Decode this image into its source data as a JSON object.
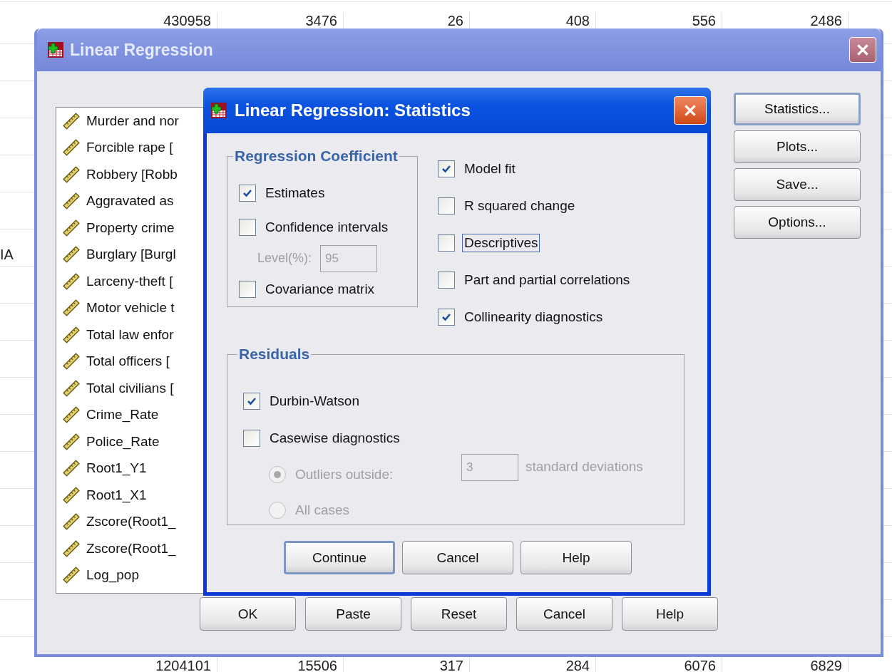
{
  "spreadsheet": {
    "top_row": [
      "430958",
      "3476",
      "26",
      "408",
      "556",
      "2486"
    ],
    "side_label": "IA",
    "bottom_row": [
      "1204101",
      "15506",
      "317",
      "284",
      "6076",
      "6829"
    ]
  },
  "main_dialog": {
    "title": "Linear Regression",
    "variables": [
      "Murder and nor",
      "Forcible rape [",
      "Robbery [Robb",
      "Aggravated as",
      "Property crime",
      "Burglary [Burgl",
      "Larceny-theft [",
      "Motor vehicle t",
      "Total law enfor",
      "Total officers [",
      "Total civilians [",
      "Crime_Rate",
      "Police_Rate",
      "Root1_Y1",
      "Root1_X1",
      "Zscore(Root1_",
      "Zscore(Root1_",
      "Log_pop"
    ],
    "side_buttons": [
      {
        "label": "Statistics...",
        "focused": true
      },
      {
        "label": "Plots...",
        "focused": false
      },
      {
        "label": "Save...",
        "focused": false
      },
      {
        "label": "Options...",
        "focused": false
      }
    ],
    "buttons": [
      "OK",
      "Paste",
      "Reset",
      "Cancel",
      "Help"
    ]
  },
  "statistics_dialog": {
    "title": "Linear Regression: Statistics",
    "coefficients": {
      "legend": "Regression Coefficient",
      "items": [
        {
          "kind": "checkbox",
          "label": "Estimates",
          "checked": true
        },
        {
          "kind": "checkbox",
          "label": "Confidence intervals",
          "checked": false
        },
        {
          "kind": "field",
          "label": "Level(%):",
          "value": "95",
          "disabled": true
        },
        {
          "kind": "checkbox",
          "label": "Covariance matrix",
          "checked": false
        }
      ]
    },
    "model_options": [
      {
        "label": "Model fit",
        "checked": true,
        "focused": false
      },
      {
        "label": "R squared change",
        "checked": false,
        "focused": false
      },
      {
        "label": "Descriptives",
        "checked": false,
        "focused": true
      },
      {
        "label": "Part and partial correlations",
        "checked": false,
        "focused": false
      },
      {
        "label": "Collinearity diagnostics",
        "checked": true,
        "focused": false
      }
    ],
    "residuals": {
      "legend": "Residuals",
      "items": [
        {
          "kind": "checkbox",
          "label": "Durbin-Watson",
          "checked": true
        },
        {
          "kind": "checkbox",
          "label": "Casewise diagnostics",
          "checked": false
        },
        {
          "kind": "radio",
          "label": "Outliers outside:",
          "selected": true,
          "disabled": true,
          "value": "3",
          "suffix": "standard deviations"
        },
        {
          "kind": "radio",
          "label": "All cases",
          "selected": false,
          "disabled": true
        }
      ]
    },
    "buttons": [
      {
        "label": "Continue",
        "default": true
      },
      {
        "label": "Cancel",
        "default": false
      },
      {
        "label": "Help",
        "default": false
      }
    ]
  }
}
